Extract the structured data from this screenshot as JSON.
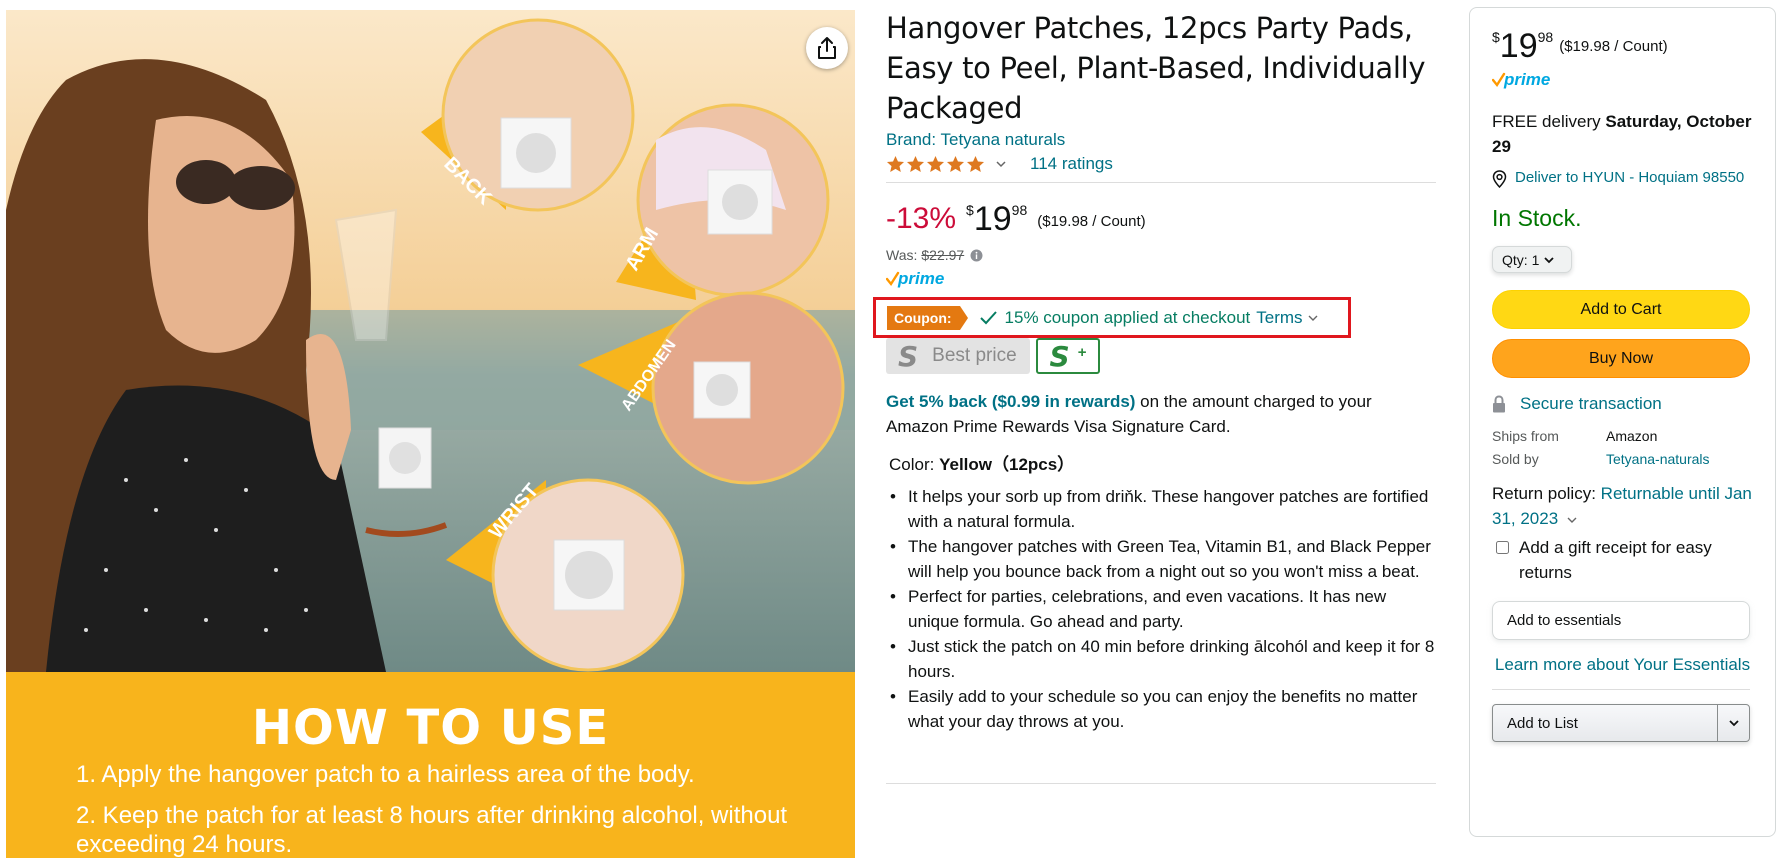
{
  "image": {
    "label_back": "BACK",
    "label_arm": "ARM",
    "label_abdomen": "ABDOMEN",
    "label_wrist": "WRIST",
    "how_to_title": "HOW TO USE",
    "step_1": "1. Apply the hangover patch to a hairless area of the body.",
    "step_2": "2. Keep the patch for at least 8 hours after drinking alcohol, without exceeding 24 hours.",
    "share_icon": "share-icon"
  },
  "product": {
    "title": "Hangover Patches, 12pcs Party Pads, Easy to Peel, Plant-Based, Individually Packaged",
    "brand": "Brand: Tetyana naturals",
    "rating_stars": 4.8,
    "ratings_count": "114 ratings",
    "discount": "-13%",
    "price_symbol": "$",
    "price_whole": "19",
    "price_fraction": "98",
    "unit_price": "($19.98 / Count)",
    "was_label": "Was:",
    "was_price": "$22.97",
    "prime_logo": "prime",
    "coupon_badge": "Coupon:",
    "coupon_text": "15% coupon applied at checkout",
    "coupon_terms": "Terms",
    "best_price_s": "S",
    "best_price_label": "Best price",
    "s_plus_s": "S",
    "s_plus_plus": "+",
    "rewards_link": "Get 5% back ($0.99 in rewards)",
    "rewards_text": " on the amount charged to your Amazon Prime Rewards Visa Signature Card.",
    "color_label": "Color:",
    "color_value": "Yellow（12pcs）",
    "bullets": [
      "It helps your sorb up from driňk. These hangover patches are fortified with a natural formula.",
      "The hangover patches with Green Tea, Vitamin B1, and Black Pepper will help you bounce back from a night out so you won't miss a beat.",
      "Perfect for parties, celebrations, and even vacations. It has new unique formula. Go ahead and party.",
      "Just stick the patch on 40 min before drinking ālcohól and keep it for 8 hours.",
      "Easily add to your schedule so you can enjoy the benefits no matter what your day throws at you."
    ]
  },
  "buy_box": {
    "price_symbol": "$",
    "price_whole": "19",
    "price_fraction": "98",
    "unit_price": "($19.98 / Count)",
    "prime_logo": "prime",
    "delivery_prefix": "FREE delivery ",
    "delivery_date": "Saturday, October 29",
    "deliver_to": "Deliver to HYUN - Hoquiam 98550",
    "in_stock": "In Stock.",
    "qty_label": "Qty:",
    "qty_value": "1",
    "add_to_cart": "Add to Cart",
    "buy_now": "Buy Now",
    "secure": "Secure transaction",
    "ships_from_label": "Ships from",
    "ships_from_value": "Amazon",
    "sold_by_label": "Sold by",
    "sold_by_value": "Tetyana-naturals",
    "return_label": "Return policy: ",
    "return_link": "Returnable until Jan 31, 2023",
    "gift_receipt": "Add a gift receipt for easy returns",
    "add_to_essentials": "Add to essentials",
    "learn_more": "Learn more about Your Essentials",
    "add_to_list": "Add to List"
  },
  "colors": {
    "link": "#007185",
    "discount": "#cc0c39",
    "in_stock": "#007600",
    "add_to_cart": "#ffd814",
    "buy_now": "#ffa41c",
    "coupon_badge": "#e47911",
    "coupon_highlight": "#e0171e",
    "image_band": "#f8b41c"
  }
}
